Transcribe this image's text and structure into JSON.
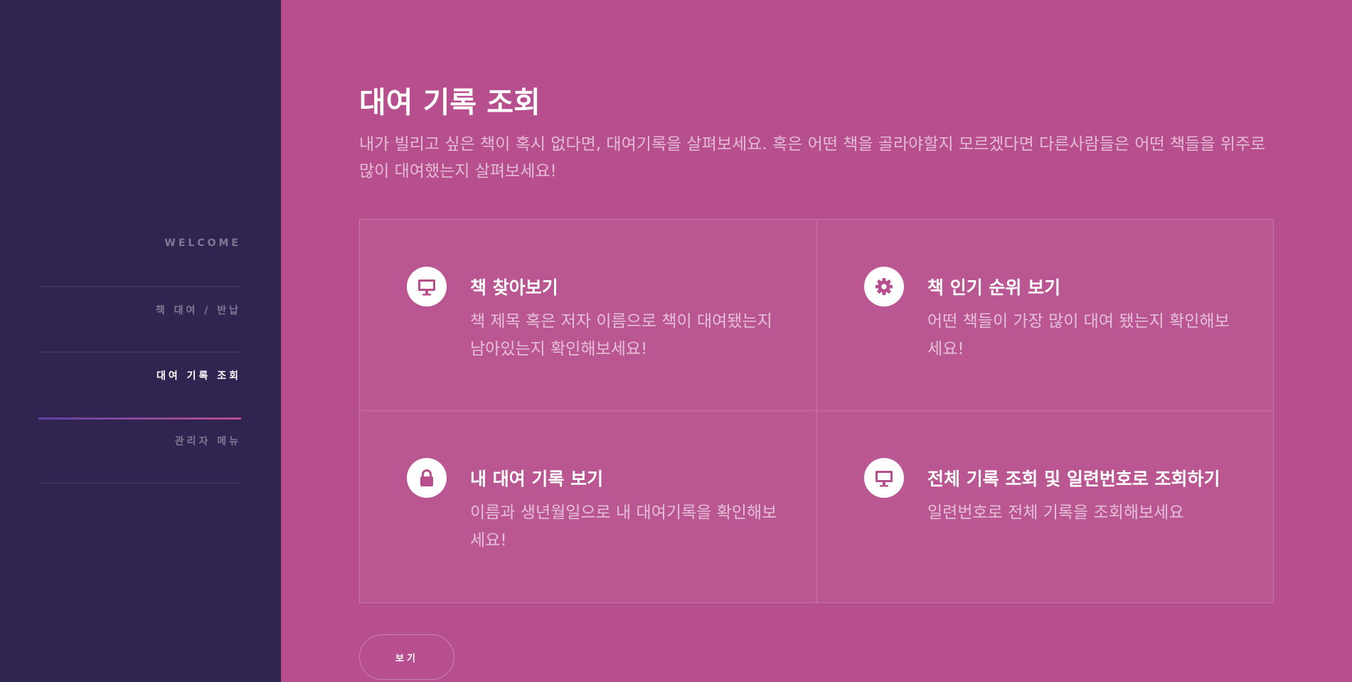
{
  "sidebar": {
    "items": [
      {
        "label": "WELCOME",
        "active": false
      },
      {
        "label": "책 대여 / 반납",
        "active": false
      },
      {
        "label": "대여 기록 조회",
        "active": true
      },
      {
        "label": "관리자 메뉴",
        "active": false
      }
    ]
  },
  "main": {
    "title": "대여 기록 조회",
    "intro": "내가 빌리고 싶은 책이 혹시 없다면, 대여기록을 살펴보세요. 혹은 어떤 책을 골라야할지 모르겠다면 다른사람들은 어떤 책들을 위주로 많이 대여했는지 살펴보세요!",
    "features": [
      {
        "icon": "desktop-icon",
        "title": "책 찾아보기",
        "desc": "책 제목 혹은 저자 이름으로 책이 대여됐는지 남아있는지 확인해보세요!"
      },
      {
        "icon": "gear-icon",
        "title": "책 인기 순위 보기",
        "desc": "어떤 책들이 가장 많이 대여 됐는지 확인해보세요!"
      },
      {
        "icon": "lock-icon",
        "title": "내 대여 기록 보기",
        "desc": "이름과 생년월일으로 내 대여기록을 확인해보세요!"
      },
      {
        "icon": "desktop-icon",
        "title": "전체 기록 조회 및 일련번호로 조회하기",
        "desc": "일련번호로 전체 기록을 조회해보세요"
      }
    ],
    "button_label": "보기"
  },
  "colors": {
    "sidebar_bg": "#312450",
    "main_bg": "#b74e8e",
    "accent_gradient": [
      "#5e42a6",
      "#b74e91"
    ]
  }
}
